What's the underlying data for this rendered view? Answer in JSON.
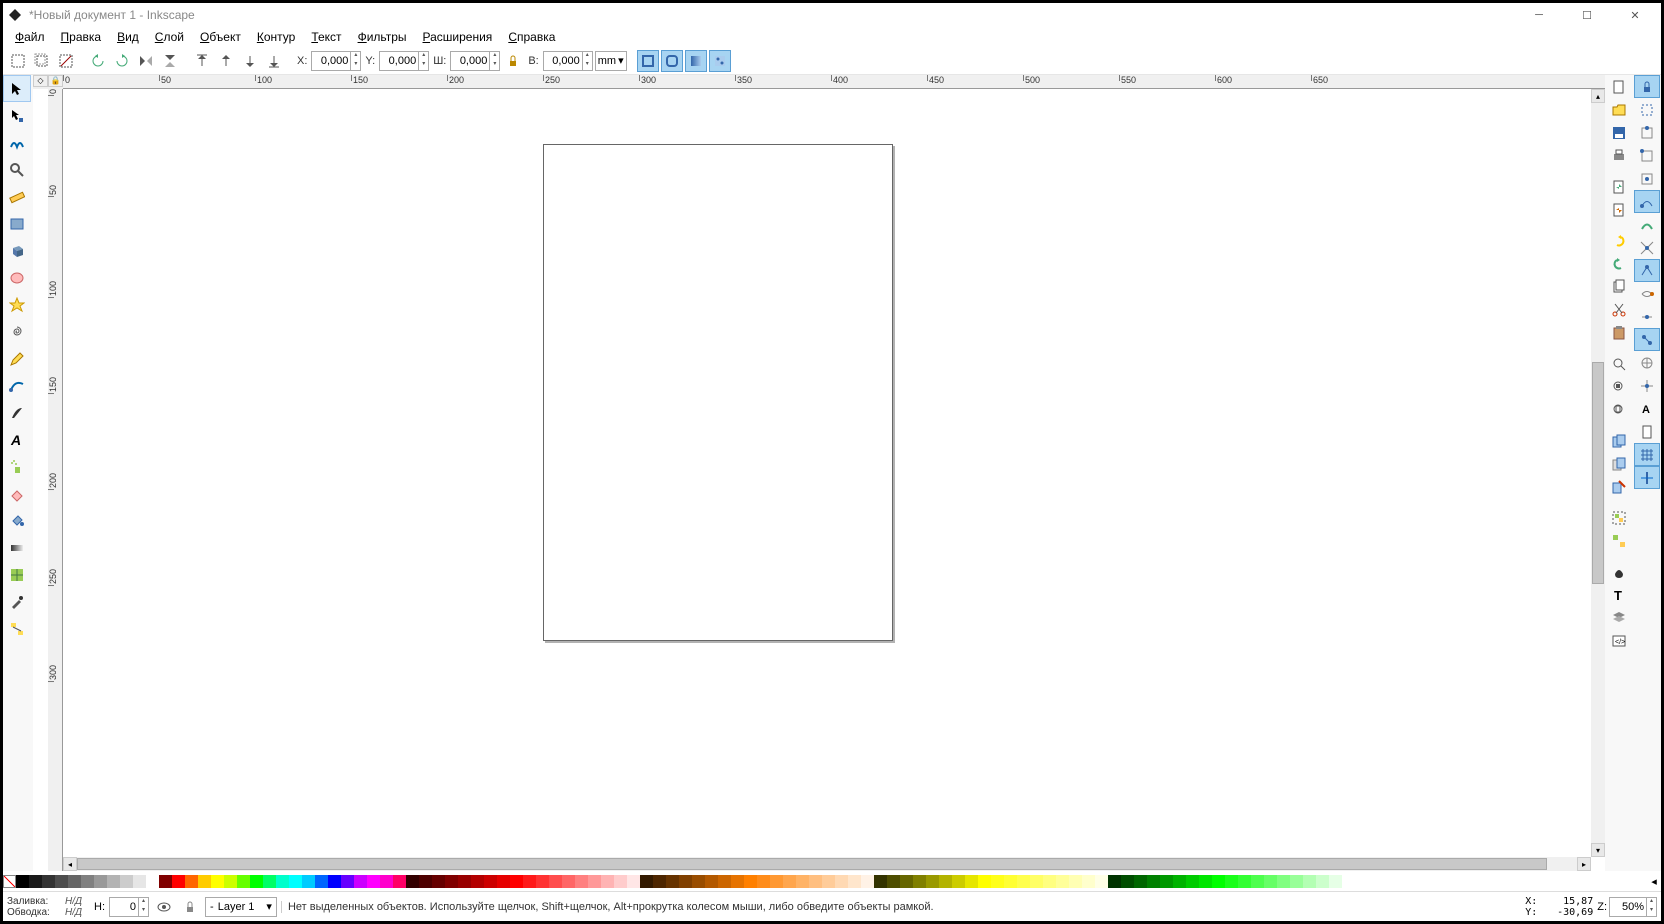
{
  "title": "*Новый документ 1 - Inkscape",
  "menu": {
    "file": "Файл",
    "edit": "Правка",
    "view": "Вид",
    "layer": "Слой",
    "object": "Объект",
    "path": "Контур",
    "text": "Текст",
    "filters": "Фильтры",
    "extensions": "Расширения",
    "help": "Справка"
  },
  "toolbar": {
    "x_label": "X:",
    "x_value": "0,000",
    "y_label": "Y:",
    "y_value": "0,000",
    "w_label": "Ш:",
    "w_value": "0,000",
    "h_label": "В:",
    "h_value": "0,000",
    "unit": "mm"
  },
  "ruler_h": [
    "0",
    "50",
    "100",
    "150",
    "200",
    "250",
    "300",
    "350",
    "400",
    "450",
    "500",
    "550",
    "600",
    "650"
  ],
  "ruler_v": [
    "0",
    "50",
    "100",
    "150",
    "200",
    "250",
    "300"
  ],
  "status": {
    "fill_label": "Заливка:",
    "fill_value": "Н/Д",
    "stroke_label": "Обводка:",
    "stroke_value": "Н/Д",
    "h_label": "Н:",
    "h_value": "0",
    "layer": "Layer 1",
    "message": "Нет выделенных объектов. Используйте щелчок, Shift+щелчок, Alt+прокрутка колесом мыши, либо обведите объекты рамкой.",
    "coord_x_label": "X:",
    "coord_x": "15,87",
    "coord_y_label": "Y:",
    "coord_y": "-30,69",
    "zoom_label": "Z:",
    "zoom": "50%"
  },
  "palette": [
    "#000000",
    "#1a1a1a",
    "#333333",
    "#4d4d4d",
    "#666666",
    "#808080",
    "#999999",
    "#b3b3b3",
    "#cccccc",
    "#e6e6e6",
    "#ffffff",
    "#800000",
    "#ff0000",
    "#ff6600",
    "#ffcc00",
    "#ffff00",
    "#ccff00",
    "#66ff00",
    "#00ff00",
    "#00ff66",
    "#00ffcc",
    "#00ffff",
    "#00ccff",
    "#0066ff",
    "#0000ff",
    "#6600ff",
    "#cc00ff",
    "#ff00ff",
    "#ff00cc",
    "#ff0066",
    "#330000",
    "#4d0000",
    "#660000",
    "#800000",
    "#990000",
    "#b30000",
    "#cc0000",
    "#e60000",
    "#ff0000",
    "#ff1a1a",
    "#ff3333",
    "#ff4d4d",
    "#ff6666",
    "#ff8080",
    "#ff9999",
    "#ffb3b3",
    "#ffcccc",
    "#ffe6e6",
    "#331a00",
    "#4d2600",
    "#663300",
    "#804000",
    "#994d00",
    "#b35900",
    "#cc6600",
    "#e67300",
    "#ff8000",
    "#ff8c1a",
    "#ff9933",
    "#ffa64d",
    "#ffb366",
    "#ffbf80",
    "#ffcc99",
    "#ffd9b3",
    "#ffe6cc",
    "#fff2e6",
    "#333300",
    "#4d4d00",
    "#666600",
    "#808000",
    "#999900",
    "#b3b300",
    "#cccc00",
    "#e6e600",
    "#ffff00",
    "#ffff1a",
    "#ffff33",
    "#ffff4d",
    "#ffff66",
    "#ffff80",
    "#ffff99",
    "#ffffb3",
    "#ffffcc",
    "#ffffe6",
    "#003300",
    "#004d00",
    "#006600",
    "#008000",
    "#009900",
    "#00b300",
    "#00cc00",
    "#00e600",
    "#00ff00",
    "#1aff1a",
    "#33ff33",
    "#4dff4d",
    "#66ff66",
    "#80ff80",
    "#99ff99",
    "#b3ffb3",
    "#ccffcc",
    "#e6ffe6"
  ]
}
